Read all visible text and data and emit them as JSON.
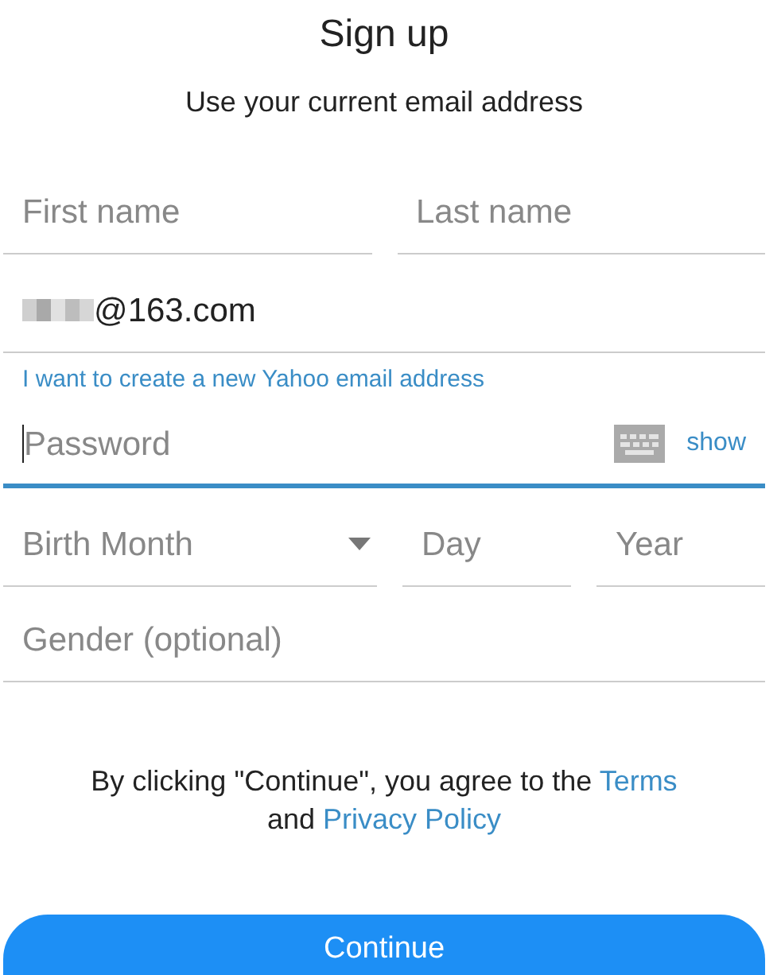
{
  "title": "Sign up",
  "subtitle": "Use your current email address",
  "name_fields": [
    {
      "placeholder": "First name"
    },
    {
      "placeholder": "Last name"
    }
  ],
  "email": {
    "value": "@163.com",
    "redacted": true
  },
  "yahoo_link": "I want to create a new Yahoo email address",
  "password": {
    "placeholder": "Password",
    "focused": true,
    "toggle": "show"
  },
  "birth_fields": [
    {
      "kind": "select",
      "placeholder": "Birth Month"
    },
    {
      "kind": "text",
      "placeholder": "Day"
    },
    {
      "kind": "text",
      "placeholder": "Year"
    }
  ],
  "gender": {
    "placeholder": "Gender (optional)"
  },
  "agreement": {
    "text": "By clicking \"Continue\", you agree to the",
    "links": [
      "Terms",
      "Privacy Policy"
    ],
    "joiner": "and"
  },
  "continue_button": "Continue"
}
